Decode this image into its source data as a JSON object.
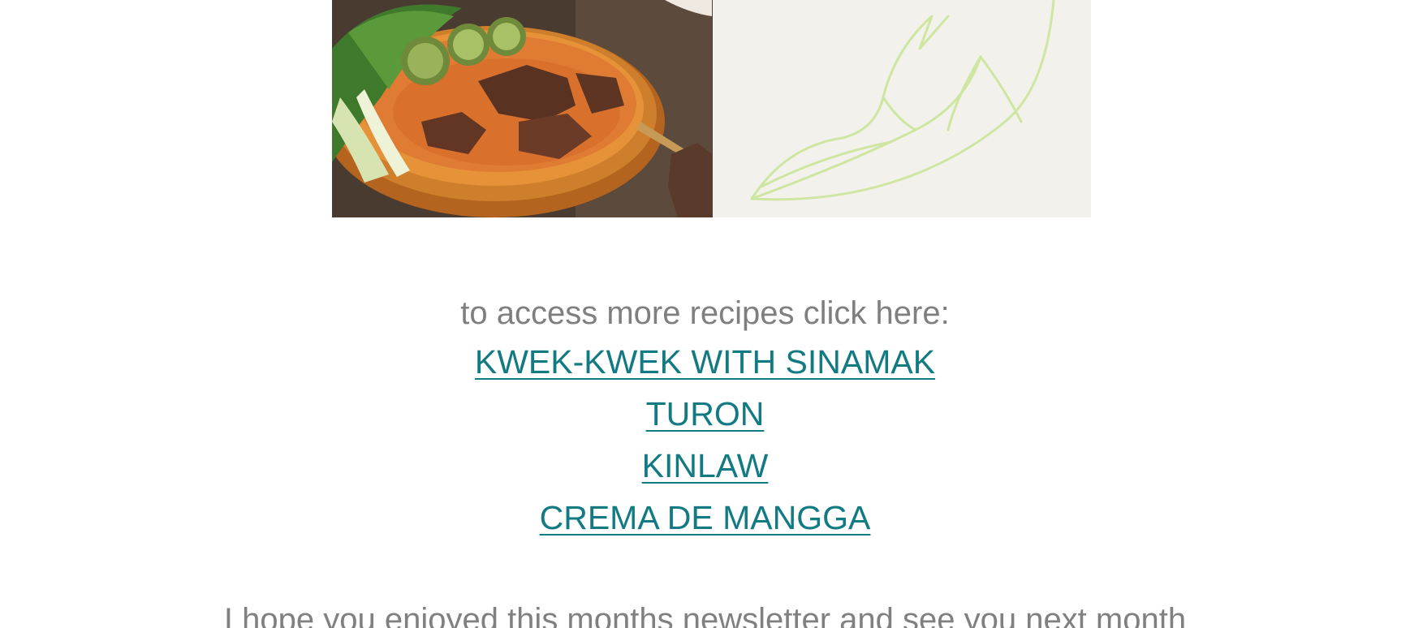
{
  "hero": {
    "photo_label": "beef stew bowl photo",
    "panel_label": "leaf illustration"
  },
  "cta": {
    "text": "to access more recipes click here:"
  },
  "recipes": [
    {
      "label": "KWEK-KWEK WITH SINAMAK"
    },
    {
      "label": "TURON"
    },
    {
      "label": "KINLAW"
    },
    {
      "label": "CREMA DE MANGGA"
    }
  ],
  "closing": {
    "text": "I hope you enjoyed this months newsletter and see you next month"
  },
  "colors": {
    "link": "#127a83",
    "text": "#7f7f7f",
    "panel_bg": "#f2f1eb",
    "leaf_stroke": "#cfe6a2"
  }
}
